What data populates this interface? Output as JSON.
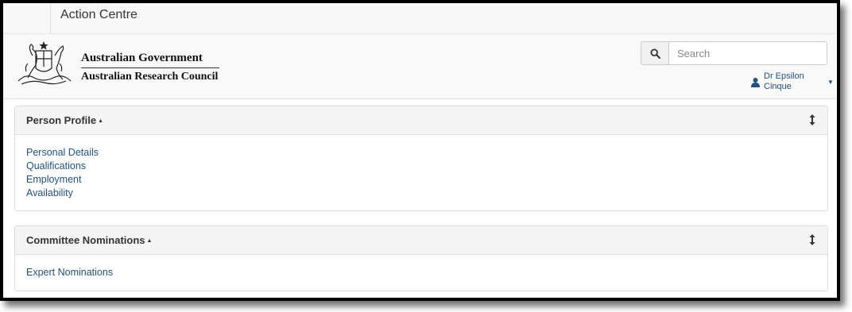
{
  "topbar": {
    "title": "Action Centre"
  },
  "header": {
    "logo": {
      "line1": "Australian Government",
      "line2": "Australian Research Council"
    },
    "search": {
      "placeholder": "Search",
      "icon": "search-icon"
    },
    "user": {
      "name": "Dr Epsilon Cinque",
      "icon": "user-icon"
    }
  },
  "panels": [
    {
      "title": "Person Profile",
      "links": [
        "Personal Details",
        "Qualifications",
        "Employment",
        "Availability"
      ]
    },
    {
      "title": "Committee Nominations",
      "links": [
        "Expert Nominations"
      ]
    }
  ],
  "colors": {
    "link": "#23527c",
    "header_bg": "#f9f9f9",
    "panel_head_bg": "#f5f5f5"
  }
}
